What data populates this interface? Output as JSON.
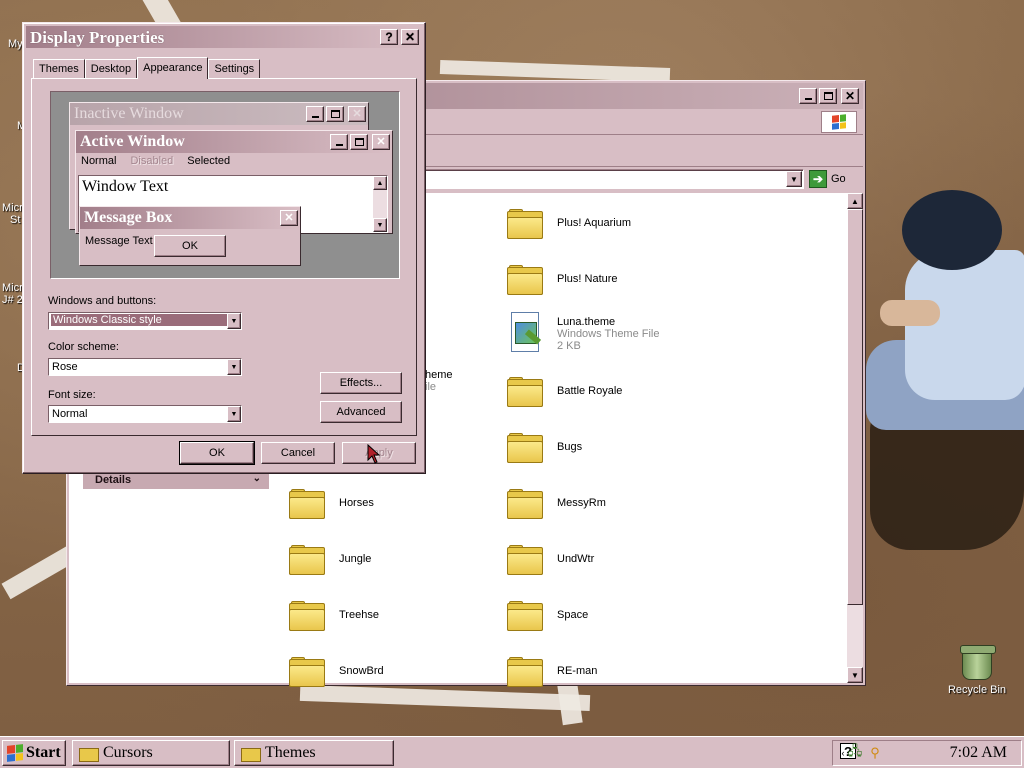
{
  "desktop": {
    "left_labels": [
      "My",
      "M",
      "Micr",
      "St",
      "Micr",
      "J# 2",
      "D"
    ],
    "recycle_bin_label": "Recycle Bin"
  },
  "explorer": {
    "address_go": "Go",
    "details_label": "Details",
    "partial_item": {
      "line1": "heme",
      "line2": "ile"
    },
    "items_col2": [
      {
        "name": "Plus! Aquarium",
        "type": "folder"
      },
      {
        "name": "Plus! Nature",
        "type": "folder"
      },
      {
        "name": "Luna.theme",
        "type": "theme",
        "subtitle": "Windows Theme File",
        "size": "2 KB"
      },
      {
        "name": "Battle Royale",
        "type": "folder"
      },
      {
        "name": "Bugs",
        "type": "folder"
      },
      {
        "name": "MessyRm",
        "type": "folder"
      },
      {
        "name": "UndWtr",
        "type": "folder"
      },
      {
        "name": "Space",
        "type": "folder"
      },
      {
        "name": "RE-man",
        "type": "folder"
      }
    ],
    "items_col1": [
      {
        "name": "Horses",
        "type": "folder"
      },
      {
        "name": "Jungle",
        "type": "folder"
      },
      {
        "name": "Treehse",
        "type": "folder"
      },
      {
        "name": "SnowBrd",
        "type": "folder"
      }
    ]
  },
  "dialog": {
    "title": "Display Properties",
    "help_glyph": "?",
    "close_glyph": "✕",
    "tabs": [
      "Themes",
      "Desktop",
      "Appearance",
      "Settings"
    ],
    "active_tab": "Appearance",
    "preview": {
      "inactive_title": "Inactive Window",
      "active_title": "Active Window",
      "menu_normal": "Normal",
      "menu_disabled": "Disabled",
      "menu_selected": "Selected",
      "window_text": "Window Text",
      "msgbox_title": "Message Box",
      "msgbox_text": "Message Text",
      "msgbox_ok": "OK"
    },
    "windows_buttons_label": "Windows and buttons:",
    "windows_buttons_value": "Windows Classic style",
    "color_scheme_label": "Color scheme:",
    "color_scheme_value": "Rose",
    "font_size_label": "Font size:",
    "font_size_value": "Normal",
    "effects_button": "Effects...",
    "advanced_button": "Advanced",
    "ok_button": "OK",
    "cancel_button": "Cancel",
    "apply_button": "Apply"
  },
  "taskbar": {
    "start_label": "Start",
    "tasks": [
      {
        "label": "Cursors",
        "pressed": false
      },
      {
        "label": "Themes",
        "pressed": false
      }
    ],
    "clock": "7:02 AM"
  },
  "colors": {
    "scheme_face": "#d8bec5",
    "active_caption_start": "#a27e8a",
    "active_caption_end": "#d9bec5",
    "selection": "#9a6c7a",
    "folder_yellow": "#e8c84a"
  }
}
